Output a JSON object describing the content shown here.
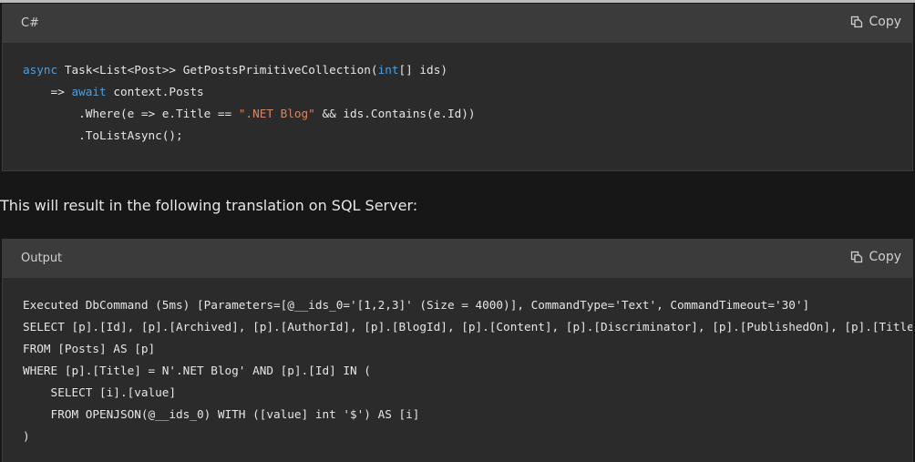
{
  "csharp_block": {
    "language_label": "C#",
    "copy_label": "Copy",
    "copy_icon": "copy-icon",
    "lines": [
      [
        {
          "t": "async",
          "c": "kw"
        },
        {
          "t": " Task<List<Post>> GetPostsPrimitiveCollection("
        },
        {
          "t": "int",
          "c": "kw"
        },
        {
          "t": "[] ids)"
        }
      ],
      [
        {
          "t": "    => "
        },
        {
          "t": "await",
          "c": "kw"
        },
        {
          "t": " context.Posts"
        }
      ],
      [
        {
          "t": "        .Where(e => e.Title == "
        },
        {
          "t": "\".NET Blog\"",
          "c": "str"
        },
        {
          "t": " && ids.Contains(e.Id))"
        }
      ],
      [
        {
          "t": "        .ToListAsync();"
        }
      ]
    ]
  },
  "prose": {
    "text": "This will result in the following translation on SQL Server:"
  },
  "output_block": {
    "language_label": "Output",
    "copy_label": "Copy",
    "copy_icon": "copy-icon",
    "lines": [
      "Executed DbCommand (5ms) [Parameters=[@__ids_0='[1,2,3]' (Size = 4000)], CommandType='Text', CommandTimeout='30']",
      "SELECT [p].[Id], [p].[Archived], [p].[AuthorId], [p].[BlogId], [p].[Content], [p].[Discriminator], [p].[PublishedOn], [p].[Title]",
      "FROM [Posts] AS [p]",
      "WHERE [p].[Title] = N'.NET Blog' AND [p].[Id] IN (",
      "    SELECT [i].[value]",
      "    FROM OPENJSON(@__ids_0) WITH ([value] int '$') AS [i]",
      ")"
    ]
  }
}
